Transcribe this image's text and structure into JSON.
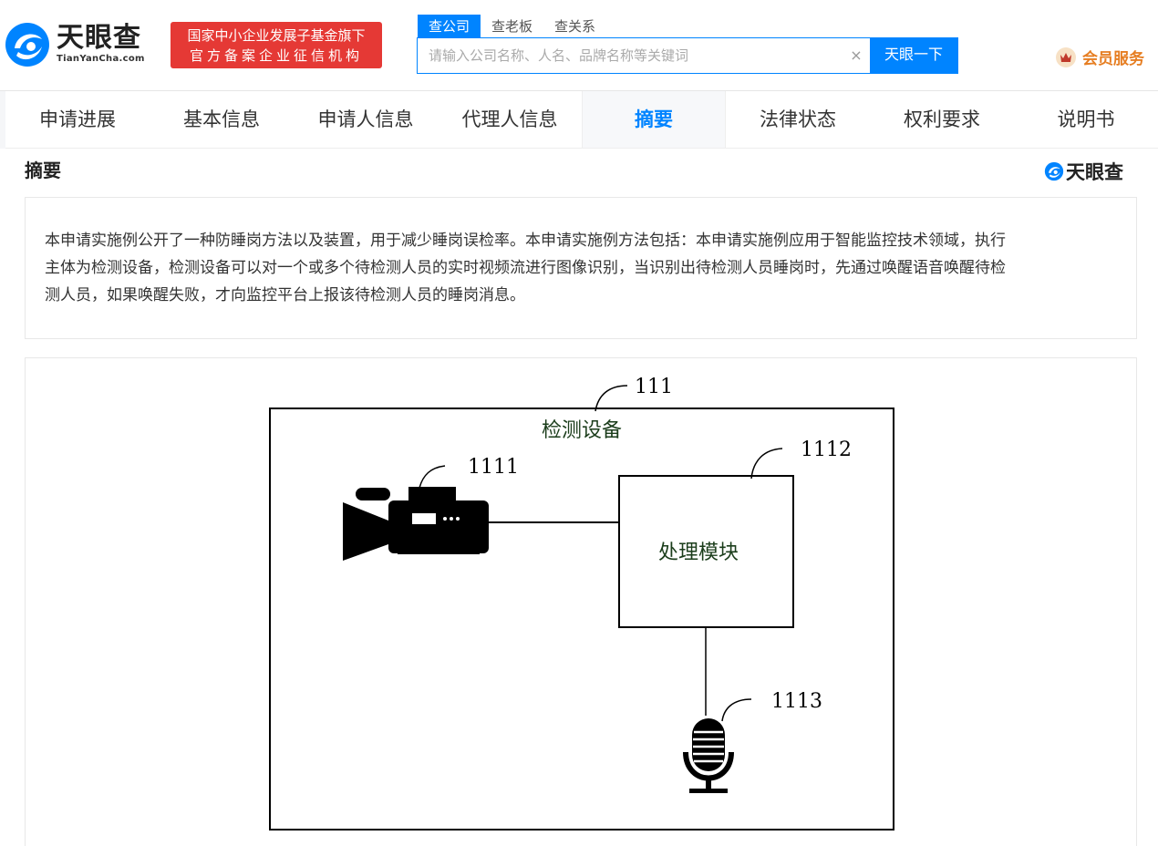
{
  "header": {
    "logo_cn": "天眼查",
    "logo_en": "TianYanCha.com",
    "badge_line1": "国家中小企业发展子基金旗下",
    "badge_line2": "官方备案企业征信机构",
    "search_tabs": [
      "查公司",
      "查老板",
      "查关系"
    ],
    "search_placeholder": "请输入公司名称、人名、品牌名称等关键词",
    "search_button": "天眼一下",
    "clear_symbol": "×",
    "vip_label": "会员服务"
  },
  "nav": {
    "items": [
      "申请进展",
      "基本信息",
      "申请人信息",
      "代理人信息",
      "摘要",
      "法律状态",
      "权利要求",
      "说明书"
    ],
    "active": "摘要"
  },
  "content": {
    "section_title": "摘要",
    "brand": "天眼查",
    "abstract_line1": "本申请实施例公开了一种防睡岗方法以及装置，用于减少睡岗误检率。本申请实施例方法包括：本申请实施例应用于智能监控技术领域，执行",
    "abstract_line2": "主体为检测设备，检测设备可以对一个或多个待检测人员的实时视频流进行图像识别，当识别出待检测人员睡岗时，先通过唤醒语音唤醒待检",
    "abstract_line3": "测人员，如果唤醒失败，才向监控平台上报该待检测人员的睡岗消息。"
  },
  "figure": {
    "outer_ref": "111",
    "outer_label": "检测设备",
    "camera_ref": "1111",
    "module_ref": "1112",
    "module_label": "处理模块",
    "mic_ref": "1113"
  },
  "colors": {
    "accent": "#0084ff",
    "badge": "#e53935",
    "vip": "#e67e22"
  }
}
